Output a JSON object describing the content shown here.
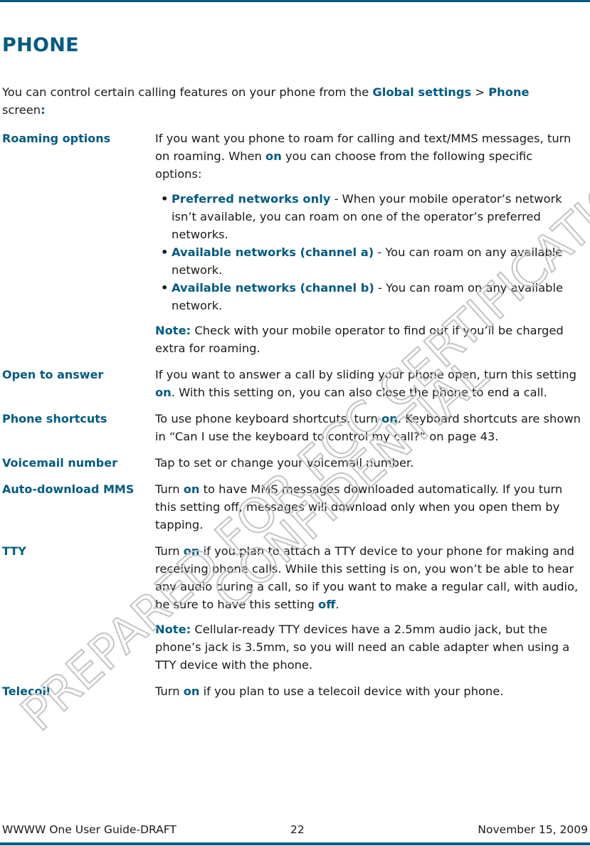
{
  "page": {
    "title": "PHONE",
    "intro": {
      "before": "You can control certain calling features on your phone from the ",
      "path_1": "Global settings",
      "separator": " > ",
      "path_2": "Phone",
      "after": " screen",
      "colon": ":"
    },
    "settings": [
      {
        "term": "Roaming options",
        "desc": {
          "part1": "If you want you phone to roam for calling and text/MMS messages, turn on roaming. When ",
          "on": "on",
          "part2": " you can choose from the following specific options:"
        },
        "bullets": [
          {
            "title": "Preferred networks only",
            "text": " - When your mobile operator’s network isn’t available, you can roam on one of the operator’s preferred networks."
          },
          {
            "title": "Available networks (channel a)",
            "text": " - You can roam on any available network."
          },
          {
            "title": "Available networks (channel b)",
            "text": " - You can roam on any available network."
          }
        ],
        "note": {
          "label": "Note:",
          "text": " Check with your mobile operator to find out if you’ll be charged extra for roaming."
        }
      },
      {
        "term": "Open to answer",
        "desc": {
          "part1": "If you want to answer a call by sliding your phone open, turn this setting ",
          "on": "on",
          "part2": ". With this setting on, you can also close the phone to end a call."
        }
      },
      {
        "term": "Phone shortcuts",
        "desc": {
          "part1": "To use phone keyboard shortcuts, turn ",
          "on": "on",
          "part2": ". Keyboard shortcuts are shown in “Can I use the keyboard to control my call?” on page 43."
        }
      },
      {
        "term": "Voicemail number",
        "desc": {
          "text": "Tap to set or change your voicemail number."
        }
      },
      {
        "term": "Auto-download MMS",
        "desc": {
          "part1": "Turn ",
          "on": "on",
          "part2": " to have MMS messages downloaded automatically. If you turn this setting off, messages will download only when you open them by tapping."
        }
      },
      {
        "term": "TTY",
        "desc": {
          "part1": "Turn ",
          "on": "on",
          "part2": " if you plan to attach a TTY device to your phone for making and receiving phone calls. While this setting is on, you won’t be able to hear any audio during a call, so if you want to make a regular call, with audio, be sure to have this setting ",
          "off": "off",
          "part3": "."
        },
        "note": {
          "label": "Note:",
          "text": " Cellular-ready TTY devices have a 2.5mm audio jack, but the phone’s jack is 3.5mm, so you will need an cable adapter when using a TTY device with the phone."
        }
      },
      {
        "term": "Telecoil",
        "desc": {
          "part1": "Turn ",
          "on": "on",
          "part2": " if you plan to use a telecoil device with your phone."
        }
      }
    ],
    "bullet_glyph": "•",
    "footer": {
      "left": "WWWW One User Guide-DRAFT",
      "page_number": "22",
      "date": "November 15, 2009"
    },
    "watermark": {
      "line1": "PREPARED FOR FCC CERTIFICATION",
      "line2": "CONFIDENTIAL"
    },
    "colors": {
      "accent": "#005b82",
      "text": "#1a1a1a",
      "watermark": "#c4c4c4"
    }
  }
}
